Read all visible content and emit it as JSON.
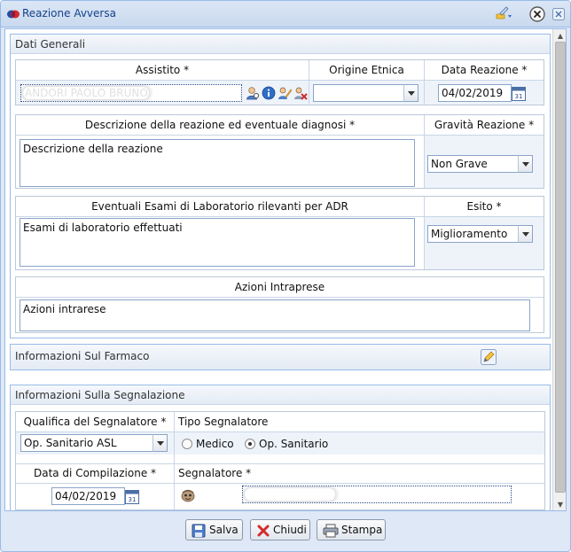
{
  "window": {
    "title": "Reazione Avversa"
  },
  "dati_generali": {
    "header": "Dati Generali",
    "assistito": {
      "label": "Assistito *",
      "value": "ANDORI PAOLO BRUNO"
    },
    "origine_etnica": {
      "label": "Origine Etnica",
      "value": ""
    },
    "data_reazione": {
      "label": "Data Reazione *",
      "value": "04/02/2019"
    },
    "descrizione": {
      "label": "Descrizione della reazione ed eventuale diagnosi *",
      "value": "Descrizione della reazione"
    },
    "gravita": {
      "label": "Gravità Reazione *",
      "value": "Non Grave"
    },
    "esami": {
      "label": "Eventuali Esami di Laboratorio rilevanti per ADR",
      "value": "Esami di laboratorio effettuati"
    },
    "esito": {
      "label": "Esito *",
      "value": "Miglioramento"
    },
    "azioni": {
      "label": "Azioni Intraprese",
      "value": "Azioni intrarese"
    }
  },
  "farmaco": {
    "header": "Informazioni Sul Farmaco"
  },
  "segnalazione": {
    "header": "Informazioni Sulla Segnalazione",
    "qualifica": {
      "label": "Qualifica del Segnalatore *",
      "value": "Op. Sanitario ASL"
    },
    "tipo": {
      "label": "Tipo Segnalatore",
      "options": [
        "Medico",
        "Op. Sanitario"
      ],
      "selected": "Op. Sanitario"
    },
    "data_compilazione": {
      "label": "Data di Compilazione *",
      "value": "04/02/2019"
    },
    "segnalatore": {
      "label": "Segnalatore *",
      "value": ""
    }
  },
  "buttons": {
    "save": "Salva",
    "close": "Chiudi",
    "print": "Stampa"
  },
  "colors": {
    "accent": "#15428b",
    "border": "#99bbe8",
    "header_bg": "#dfe8f6"
  }
}
